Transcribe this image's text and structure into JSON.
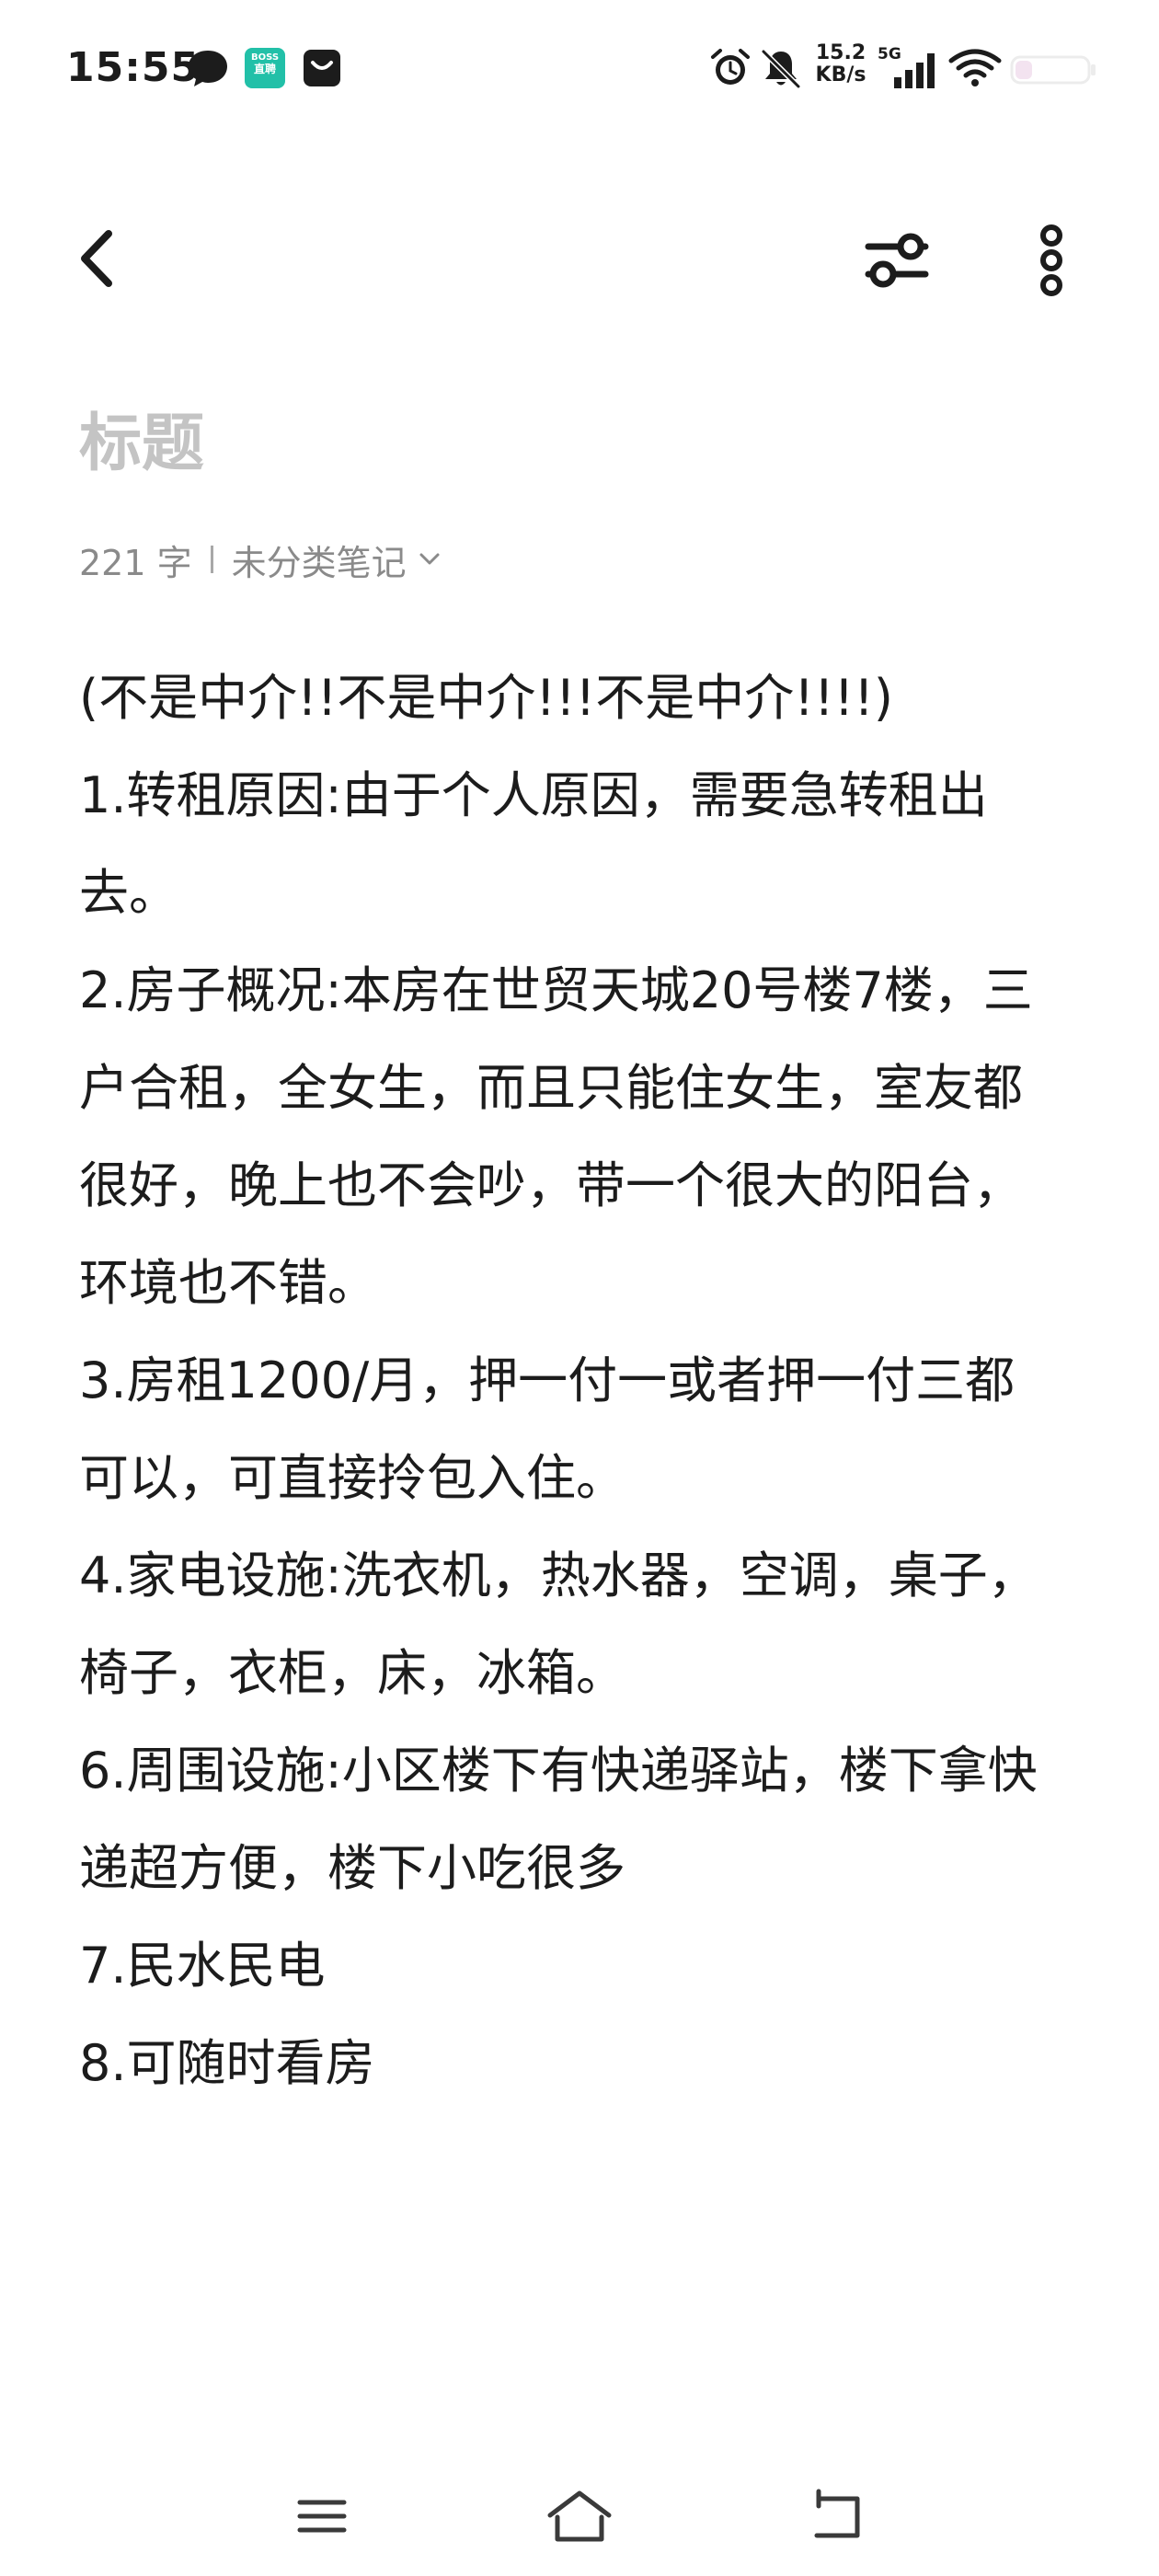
{
  "status_bar": {
    "time": "15:55",
    "boss_label_top": "BOSS",
    "boss_label_bottom": "直聘",
    "net_speed_value": "15.2",
    "net_speed_unit": "KB/s",
    "network_type": "5G",
    "icons": [
      "message-icon",
      "boss-app-icon",
      "bag-icon",
      "alarm-icon",
      "mute-icon",
      "signal-icon",
      "wifi-icon",
      "battery-icon"
    ]
  },
  "toolbar": {
    "icons": [
      "back-icon",
      "filter-icon",
      "more-icon"
    ]
  },
  "note": {
    "title_placeholder": "标题",
    "word_count": "221 字",
    "category": "未分类笔记",
    "lines": [
      "(不是中介!!不是中介!!!不是中介!!!!)",
      "1.转租原因:由于个人原因，需要急转租出",
      "去。",
      "2.房子概况:本房在世贸天城20号楼7楼，三",
      "户合租，全女生，而且只能住女生，室友都",
      "很好，晚上也不会吵，带一个很大的阳台，",
      "环境也不错。",
      "3.房租1200/月，押一付一或者押一付三都",
      "可以，可直接拎包入住。",
      "4.家电设施:洗衣机，热水器，空调，桌子，",
      "椅子，衣柜，床，冰箱。",
      "6.周围设施:小区楼下有快递驿站，楼下拿快",
      "递超方便，楼下小吃很多",
      "7.民水民电",
      "8.可随时看房"
    ]
  },
  "nav_bar": {
    "icons": [
      "menu-icon",
      "home-icon",
      "back-nav-icon"
    ]
  },
  "colors": {
    "text": "#1c1c1c",
    "placeholder": "#c4c4c4",
    "meta": "#8a8a8a",
    "boss_green": "#22c0a8"
  }
}
